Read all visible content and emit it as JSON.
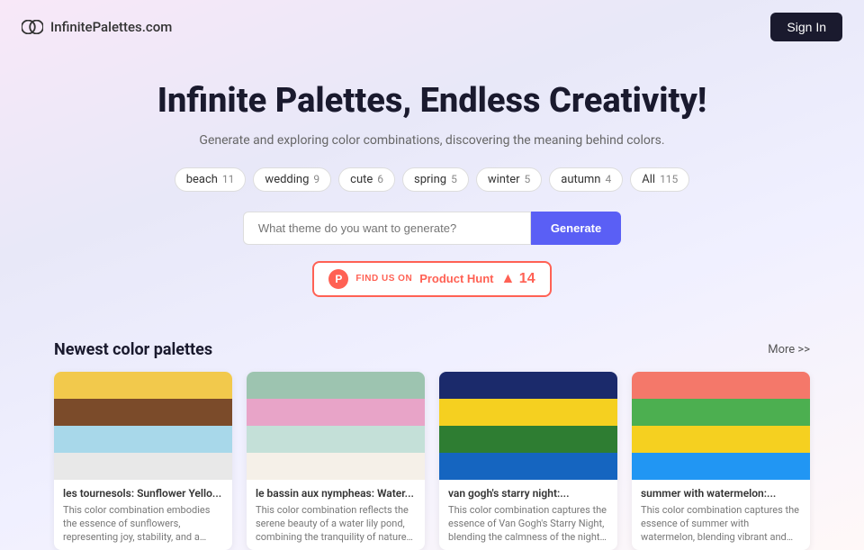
{
  "header": {
    "logo_text": "InfinitePalettes.com",
    "sign_in_label": "Sign In"
  },
  "hero": {
    "title": "Infinite Palettes, Endless Creativity!",
    "subtitle": "Generate and exploring color combinations, discovering the meaning behind colors."
  },
  "tags": [
    {
      "label": "beach",
      "count": "11"
    },
    {
      "label": "wedding",
      "count": "9"
    },
    {
      "label": "cute",
      "count": "6"
    },
    {
      "label": "spring",
      "count": "5"
    },
    {
      "label": "winter",
      "count": "5"
    },
    {
      "label": "autumn",
      "count": "4"
    },
    {
      "label": "All",
      "count": "115"
    }
  ],
  "search": {
    "placeholder": "What theme do you want to generate?",
    "generate_label": "Generate"
  },
  "product_hunt": {
    "label": "Product Hunt",
    "icon_letter": "P",
    "count": "14"
  },
  "palettes_section": {
    "title": "Newest color palettes",
    "more_label": "More >>",
    "palettes": [
      {
        "name": "les tournesols: Sunflower Yello...",
        "description": "This color combination embodies the essence of sunflowers, representing joy, stability, and a connection to nature. Th...",
        "colors": [
          "#F2C94C",
          "#7B4B2A",
          "#A8D8EA",
          "#E8E8E8"
        ]
      },
      {
        "name": "le bassin aux nympheas: Water...",
        "description": "This color combination reflects the serene beauty of a water lily pond, combining the tranquility of nature with...",
        "colors": [
          "#9DC4B0",
          "#E8A4C8",
          "#C4E0D8",
          "#F5F0E8"
        ]
      },
      {
        "name": "van gogh's starry night:...",
        "description": "This color combination captures the essence of Van Gogh's Starry Night, blending the calmness of the night sky...",
        "colors": [
          "#1B2A6B",
          "#F5D020",
          "#2E7D32",
          "#1565C0"
        ]
      },
      {
        "name": "summer with watermelon:...",
        "description": "This color combination captures the essence of summer with watermelon, blending vibrant and refreshing hues th...",
        "colors": [
          "#F4786A",
          "#4CAF50",
          "#F5D020",
          "#2196F3"
        ]
      }
    ]
  }
}
